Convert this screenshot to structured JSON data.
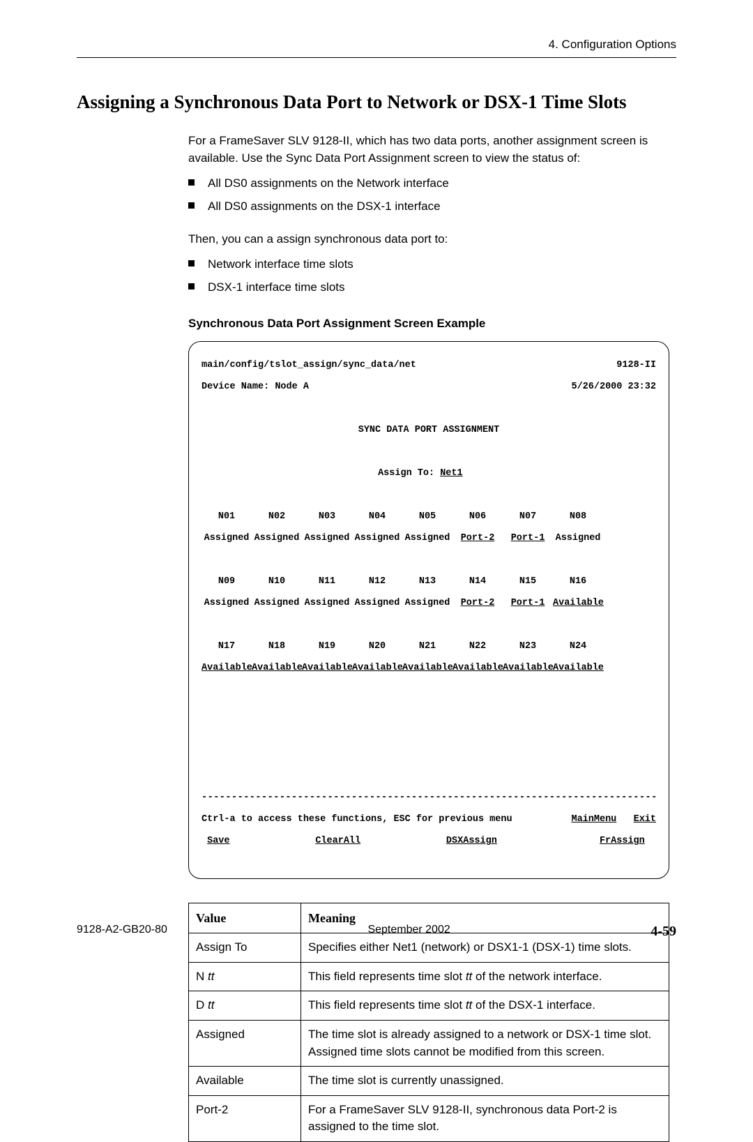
{
  "header": {
    "chapter": "4. Configuration Options"
  },
  "title": "Assigning a Synchronous Data Port to Network or DSX-1 Time Slots",
  "intro": "For a FrameSaver SLV 9128-II, which has two data ports, another assignment screen is available. Use the Sync Data Port Assignment screen to view the status of:",
  "list1": {
    "0": "All DS0 assignments on the Network interface",
    "1": "All DS0 assignments on the DSX-1 interface"
  },
  "then": "Then, you can a assign synchronous data port to:",
  "list2": {
    "0": "Network interface time slots",
    "1": "DSX-1 interface time slots"
  },
  "sub_heading": "Synchronous Data Port Assignment Screen Example",
  "terminal": {
    "path": "main/config/tslot_assign/sync_data/net",
    "model": "9128-II",
    "device_label": "Device Name: Node A",
    "timestamp": "5/26/2000 23:32",
    "title": "SYNC DATA PORT ASSIGNMENT",
    "assign_to_label": "Assign To: ",
    "assign_to_value": "Net1",
    "slots": {
      "r1_labels": [
        "N01",
        "N02",
        "N03",
        "N04",
        "N05",
        "N06",
        "N07",
        "N08"
      ],
      "r1_values": [
        "Assigned",
        "Assigned",
        "Assigned",
        "Assigned",
        "Assigned",
        "Port-2",
        "Port-1",
        "Assigned"
      ],
      "r1_ul": [
        false,
        false,
        false,
        false,
        false,
        true,
        true,
        false
      ],
      "r2_labels": [
        "N09",
        "N10",
        "N11",
        "N12",
        "N13",
        "N14",
        "N15",
        "N16"
      ],
      "r2_values": [
        "Assigned",
        "Assigned",
        "Assigned",
        "Assigned",
        "Assigned",
        "Port-2",
        "Port-1",
        "Available"
      ],
      "r2_ul": [
        false,
        false,
        false,
        false,
        false,
        true,
        true,
        true
      ],
      "r3_labels": [
        "N17",
        "N18",
        "N19",
        "N20",
        "N21",
        "N22",
        "N23",
        "N24"
      ],
      "r3_values": [
        "Available",
        "Available",
        "Available",
        "Available",
        "Available",
        "Available",
        "Available",
        "Available"
      ],
      "r3_ul": [
        true,
        true,
        true,
        true,
        true,
        true,
        true,
        true
      ]
    },
    "help_line": "Ctrl-a to access these functions, ESC for previous menu",
    "menu1": [
      "MainMenu",
      "Exit"
    ],
    "menu2": [
      "Save",
      "ClearAll",
      "DSXAssign",
      "FrAssign"
    ]
  },
  "table": {
    "h_value": "Value",
    "h_meaning": "Meaning",
    "rows": {
      "0": {
        "v": "Assign To",
        "m": "Specifies either Net1 (network) or DSX1-1 (DSX-1) time slots."
      },
      "1": {
        "v": "N tt",
        "m": "This field represents time slot tt of the network interface."
      },
      "2": {
        "v": "D tt",
        "m": "This field represents time slot tt of the DSX-1 interface."
      },
      "3": {
        "v": "Assigned",
        "m": "The time slot is already assigned to a network or DSX-1 time slot. Assigned time slots cannot be modified from this screen."
      },
      "4": {
        "v": "Available",
        "m": "The time slot is currently unassigned."
      },
      "5": {
        "v": "Port-2",
        "m": "For a FrameSaver SLV 9128-II, synchronous data Port-2 is assigned to the time slot."
      }
    }
  },
  "footer": {
    "doc_id": "9128-A2-GB20-80",
    "date": "September 2002",
    "page": "4-59"
  }
}
